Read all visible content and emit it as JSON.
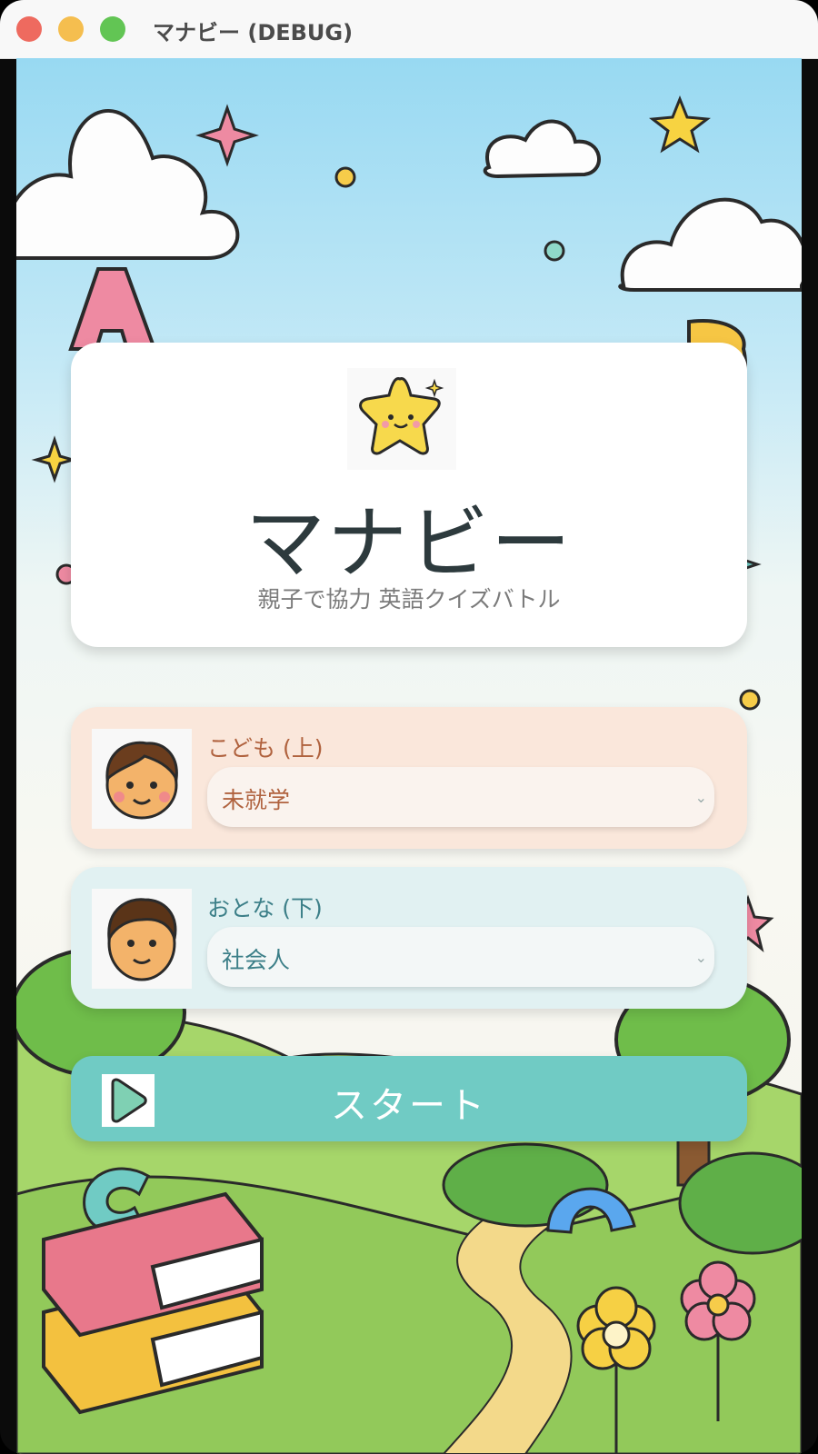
{
  "window": {
    "title": "マナビー (DEBUG)"
  },
  "header": {
    "app_title": "マナビー",
    "subtitle": "親子で協力 英語クイズバトル"
  },
  "players": [
    {
      "label": "こども (上)",
      "selected": "未就学"
    },
    {
      "label": "おとな (下)",
      "selected": "社会人"
    }
  ],
  "start_label": "スタート",
  "background_letters": [
    "A",
    "B",
    "C"
  ],
  "icons": {
    "mascot": "smiling-star-icon",
    "child_avatar": "boy-face-icon",
    "adult_avatar": "man-face-icon",
    "start": "play-icon"
  },
  "colors": {
    "child_card": "#fae7db",
    "adult_card": "#e1f1f2",
    "start_button": "#70cbc4",
    "child_text": "#b0623e",
    "adult_text": "#3c7f88"
  }
}
